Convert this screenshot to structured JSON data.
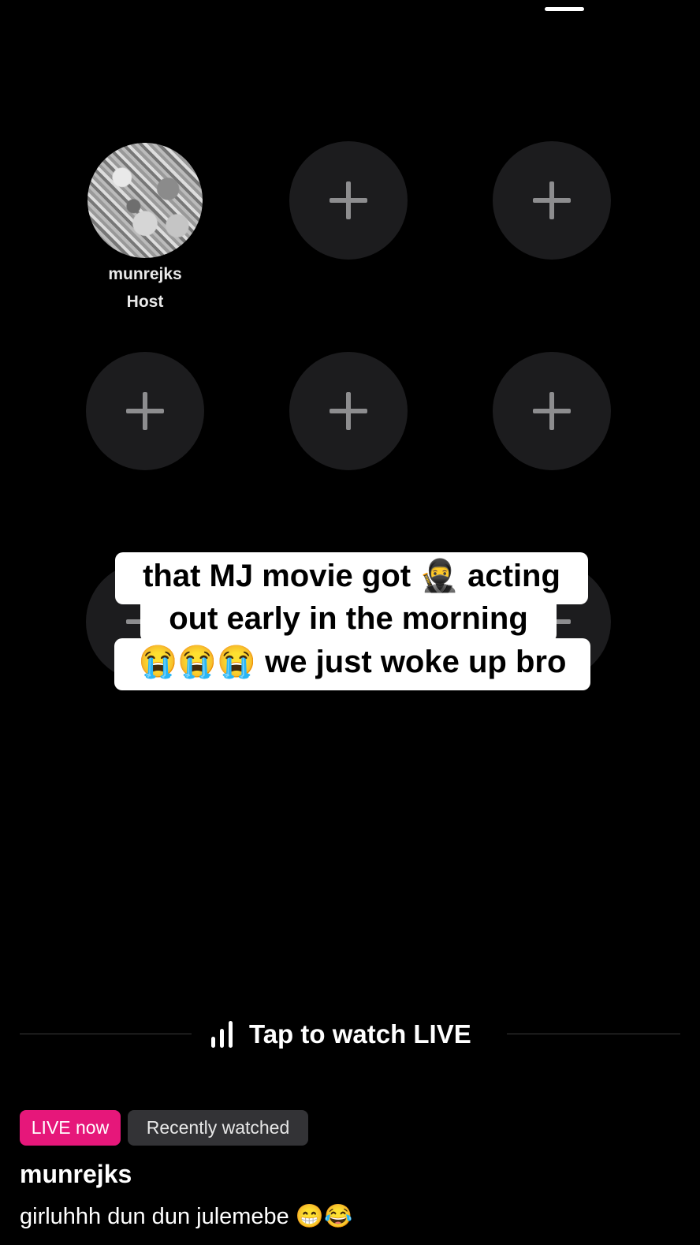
{
  "host": {
    "name": "munrejks",
    "role": "Host"
  },
  "seats": {
    "empty_icon": "plus-icon",
    "empty_count": 8
  },
  "caption": {
    "lines": [
      "that MJ movie got 🥷 acting",
      "out early in the morning",
      "😭😭😭 we just woke up bro"
    ]
  },
  "cta": {
    "icon": "live-bars-icon",
    "label": "Tap to watch LIVE"
  },
  "badges": {
    "live": "LIVE now",
    "recent": "Recently watched"
  },
  "stream": {
    "username": "munrejks",
    "comment": "girluhhh dun dun julemebe 😁😂"
  },
  "colors": {
    "background": "#000000",
    "seat": "#1c1c1e",
    "live_badge": "#e6177a",
    "recent_badge": "#333336",
    "caption_bg": "#ffffff"
  }
}
